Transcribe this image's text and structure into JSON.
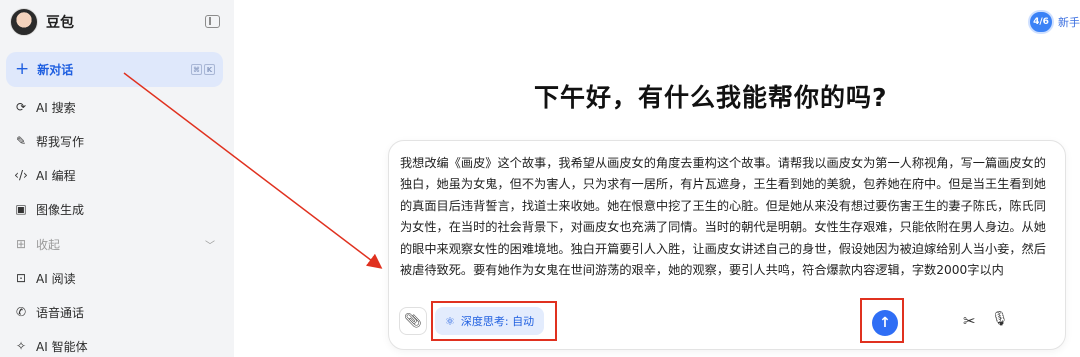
{
  "sidebar": {
    "brand_name": "豆包",
    "new_chat_label": "新对话",
    "shortcut_keys": [
      "⌘",
      "K"
    ],
    "items": [
      {
        "label": "AI 搜索",
        "icon": "search-icon"
      },
      {
        "label": "帮我写作",
        "icon": "pen-icon"
      },
      {
        "label": "AI 编程",
        "icon": "code-icon"
      },
      {
        "label": "图像生成",
        "icon": "image-icon"
      },
      {
        "label": "收起",
        "icon": "grid-icon"
      },
      {
        "label": "AI 阅读",
        "icon": "book-icon"
      },
      {
        "label": "语音通话",
        "icon": "phone-icon"
      },
      {
        "label": "AI 智能体",
        "icon": "sparkle-icon"
      }
    ]
  },
  "header": {
    "promo_badge": "4/6",
    "promo_text": "新手"
  },
  "main": {
    "greeting": "下午好，有什么我能帮你的吗?",
    "prompt": "我想改编《画皮》这个故事，我希望从画皮女的角度去重构这个故事。请帮我以画皮女为第一人称视角，写一篇画皮女的独白，她虽为女鬼，但不为害人，只为求有一居所，有片瓦遮身，王生看到她的美貌，包养她在府中。但是当王生看到她的真面目后违背誓言，找道士来收她。她在恨意中挖了王生的心脏。但是她从来没有想过要伤害王生的妻子陈氏，陈氏同为女性，在当时的社会背景下，对画皮女也充满了同情。当时的朝代是明朝。女性生存艰难，只能依附在男人身边。从她的眼中来观察女性的困难境地。独白开篇要引人入胜，让画皮女讲述自己的身世，假设她因为被迫嫁给别人当小妾，然后被虐待致死。要有她作为女鬼在世间游荡的艰辛，她的观察，要引人共鸣，符合爆款内容逻辑，字数2000字以内",
    "deep_think_label": "深度思考: 自动"
  },
  "colors": {
    "accent": "#2f6ef5",
    "highlight_frame": "#e0311f",
    "sidebar_bg": "#f3f4f6"
  }
}
